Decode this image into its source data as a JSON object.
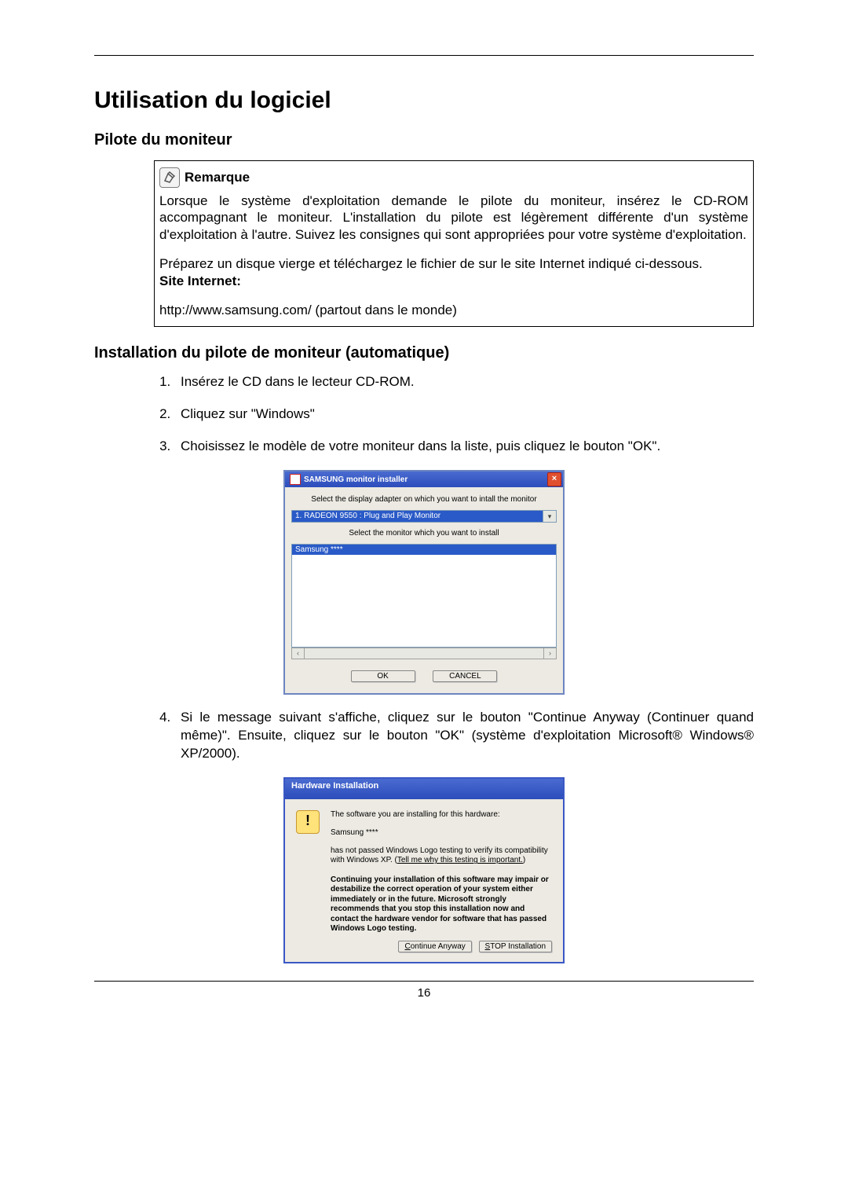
{
  "page_number": "16",
  "title": "Utilisation du logiciel",
  "section_pilote": "Pilote du moniteur",
  "note": {
    "label": "Remarque",
    "para1": "Lorsque le système d'exploitation demande le pilote du moniteur, insérez le CD-ROM accompagnant le moniteur. L'installation du pilote est légèrement différente d'un système d'exploitation à l'autre. Suivez les consignes qui sont appropriées pour votre système d'exploitation.",
    "para2": "Préparez un disque vierge et téléchargez le fichier de sur le site Internet indiqué ci-dessous.",
    "site_label": "Site Internet:",
    "url": "http://www.samsung.com/ (partout dans le monde)"
  },
  "section_install": "Installation du pilote de moniteur (automatique)",
  "steps": {
    "s1": "Insérez le CD dans le lecteur CD-ROM.",
    "s2": "Cliquez sur \"Windows\"",
    "s3": "Choisissez le modèle de votre moniteur dans la liste, puis cliquez le bouton \"OK\".",
    "s4": "Si le message suivant s'affiche, cliquez sur le bouton \"Continue Anyway (Continuer quand même)\". Ensuite, cliquez sur le bouton \"OK\" (système d'exploitation Microsoft® Windows® XP/2000)."
  },
  "installer": {
    "title": "SAMSUNG monitor installer",
    "close": "×",
    "instruction1": "Select the display adapter on which you want to intall the monitor",
    "adapter": "1. RADEON 9550 : Plug and Play Monitor",
    "dropdown_glyph": "▾",
    "instruction2": "Select the monitor which you want to install",
    "selected": "Samsung ****",
    "scroll_left": "‹",
    "scroll_right": "›",
    "ok": "OK",
    "cancel": "CANCEL"
  },
  "hw": {
    "title": "Hardware Installation",
    "line1": "The software you are installing for this hardware:",
    "device": "Samsung ****",
    "line2a": "has not passed Windows Logo testing to verify its compatibility with Windows XP. (",
    "link": "Tell me why this testing is important.",
    "line2b": ")",
    "bold": "Continuing your installation of this software may impair or destabilize the correct operation of your system either immediately or in the future. Microsoft strongly recommends that you stop this installation now and contact the hardware vendor for software that has passed Windows Logo testing.",
    "btn_continue_pre": "C",
    "btn_continue_rest": "ontinue Anyway",
    "btn_stop_pre": "S",
    "btn_stop_rest": "TOP Installation"
  }
}
